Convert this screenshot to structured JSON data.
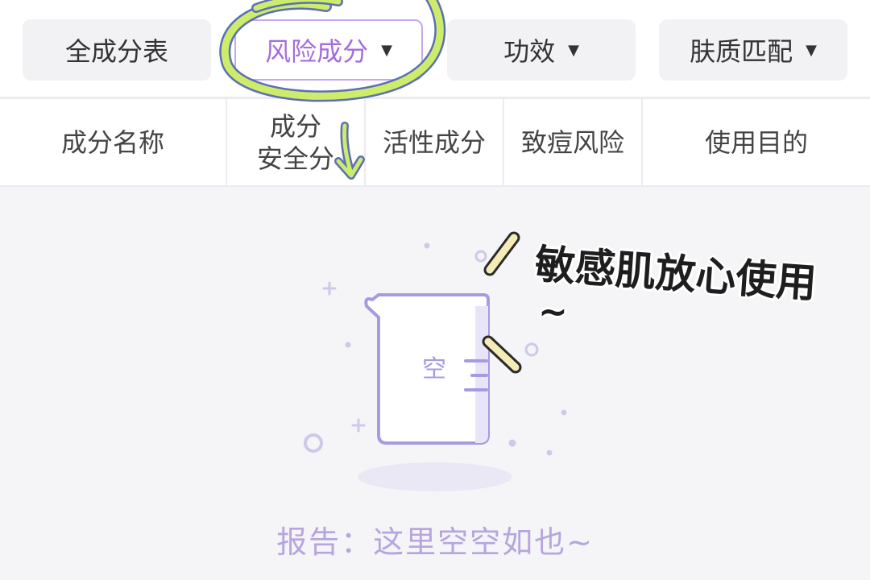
{
  "tabs": [
    {
      "label": "全成分表",
      "has_caret": false,
      "active": false
    },
    {
      "label": "风险成分",
      "has_caret": true,
      "active": true
    },
    {
      "label": "功效",
      "has_caret": true,
      "active": false
    },
    {
      "label": "肤质匹配",
      "has_caret": true,
      "active": false
    }
  ],
  "caret_glyph": "▼",
  "table": {
    "headers": [
      "成分名称",
      "成分\n安全分",
      "活性成分",
      "致痘风险",
      "使用目的"
    ]
  },
  "empty_state": {
    "beaker_label": "空",
    "message": "报告：这里空空如也~"
  },
  "annotation": {
    "note": "敏感肌放心使用",
    "tilde": "~"
  },
  "colors": {
    "accent": "#a46ddc",
    "active_border": "#c9a8ea",
    "highlight_ring": "#cdec6a",
    "ring_outline": "#5b6fb6",
    "empty_text": "#b6a5de",
    "illustration": "#a99ae0"
  }
}
